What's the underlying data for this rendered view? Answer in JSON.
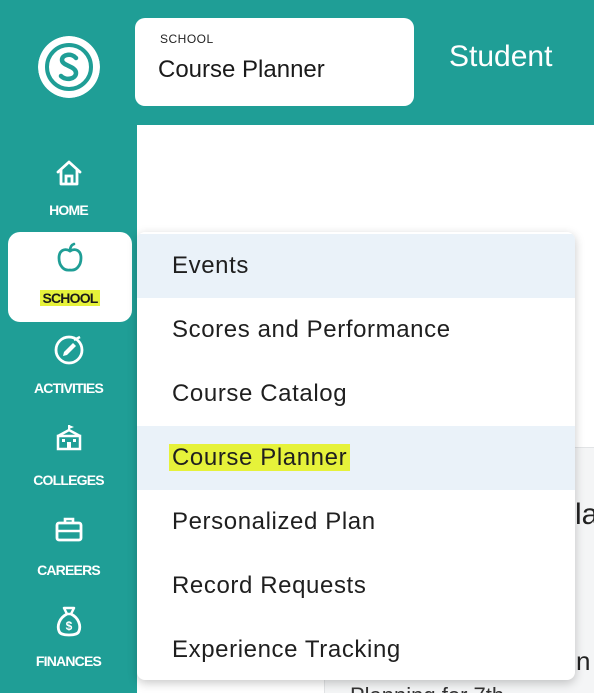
{
  "header": {
    "kicker": "SCHOOL",
    "title": "Course Planner",
    "student_text": "Student"
  },
  "sidebar": {
    "items": [
      {
        "label": "HOME",
        "icon": "home-icon"
      },
      {
        "label": "SCHOOL",
        "icon": "apple-icon",
        "active": true
      },
      {
        "label": "ACTIVITIES",
        "icon": "pencil-circle-icon"
      },
      {
        "label": "COLLEGES",
        "icon": "college-building-icon"
      },
      {
        "label": "CAREERS",
        "icon": "briefcase-icon"
      },
      {
        "label": "FINANCES",
        "icon": "money-bag-icon"
      }
    ]
  },
  "dropdown": {
    "items": [
      {
        "label": "Events",
        "active": true
      },
      {
        "label": "Scores and Performance"
      },
      {
        "label": "Course Catalog"
      },
      {
        "label": "Course Planner",
        "active": true,
        "highlighted": true
      },
      {
        "label": "Personalized Plan"
      },
      {
        "label": "Record Requests"
      },
      {
        "label": "Experience Tracking"
      }
    ]
  },
  "content": {
    "heading_partial": "la",
    "line_partial": "n",
    "bottom_partial": "Planning for 7th"
  },
  "colors": {
    "brand_teal": "#1f9e96",
    "highlight_yellow": "#e6f23a",
    "active_row": "#eaf2f9"
  }
}
